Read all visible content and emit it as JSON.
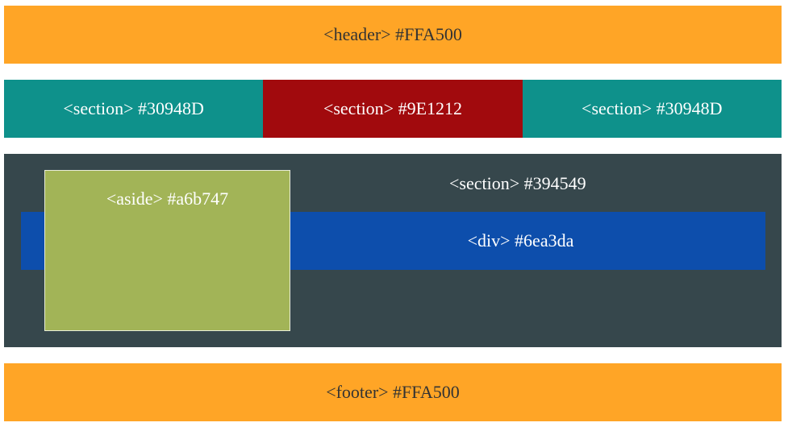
{
  "header": {
    "label": "<header> #FFA500"
  },
  "sections": [
    {
      "label": "<section> #30948D"
    },
    {
      "label": "<section> #9E1212"
    },
    {
      "label": "<section> #30948D"
    }
  ],
  "main_section": {
    "label": "<section> #394549"
  },
  "div": {
    "label": "<div> #6ea3da"
  },
  "aside": {
    "label": "<aside> #a6b747"
  },
  "footer": {
    "label": "<footer> #FFA500"
  },
  "colors": {
    "header": "#FFA526",
    "section_teal": "#0E918B",
    "section_red": "#A10A0D",
    "main_section": "#36474C",
    "div": "#0D4EAC",
    "aside": "#A2B457",
    "footer": "#FFA526"
  }
}
